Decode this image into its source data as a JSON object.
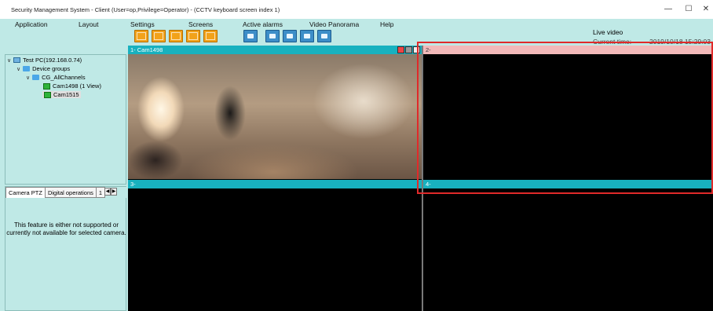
{
  "window": {
    "title": "Security Management System - Client (User=op,Privilege=Operator) - (CCTV keyboard screen index 1)",
    "controls": {
      "minimize": "—",
      "maximize": "☐",
      "close": "✕"
    }
  },
  "menu": {
    "application": "Application",
    "layout": "Layout",
    "settings": "Settings",
    "screens": "Screens",
    "active_alarms": "Active alarms",
    "video_panorama": "Video Panorama",
    "help": "Help"
  },
  "toolbar": {
    "layout_buttons": [
      "layout-1x1-icon",
      "layout-2x2-icon",
      "layout-3x3-icon",
      "layout-wide-icon",
      "layout-custom-icon"
    ],
    "action_buttons": [
      "playback-icon",
      "refresh-icon",
      "search-icon",
      "camera-settings-icon",
      "wrench-icon"
    ]
  },
  "status": {
    "mode": "Live video",
    "time_label": "Current time:",
    "time_value": "2019/10/18 15:29:03"
  },
  "tree": {
    "root": "Test PC(192.168.0.74)",
    "group": "Device groups",
    "channel_group": "CG_AllChannels",
    "cameras": [
      "Cam1498 (1 View)",
      "Cam1515"
    ]
  },
  "ptz": {
    "tabs": [
      "Camera PTZ",
      "Digital operations",
      "1"
    ],
    "message": "This feature is either not supported or currently not available for selected camera."
  },
  "video": {
    "panes": [
      {
        "label": "1- Cam1498"
      },
      {
        "label": "2-"
      },
      {
        "label": "3-"
      },
      {
        "label": "4-"
      }
    ],
    "pane1_index_text": "2"
  },
  "colors": {
    "background": "#bfe9e6",
    "pane_header": "#18b1bf",
    "selected_pane_header": "#f2b9b9",
    "highlight": "#e02a2a"
  }
}
